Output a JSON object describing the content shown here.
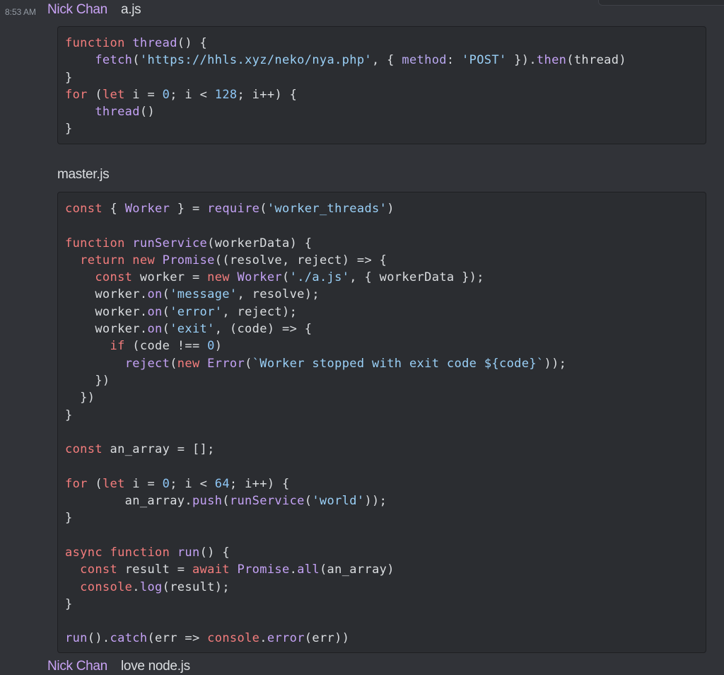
{
  "messages": [
    {
      "timestamp": "8:53 AM",
      "username": "Nick Chan",
      "text": "a.js",
      "code": "function thread() {\n    fetch('https://hhls.xyz/neko/nya.php', { method: 'POST' }).then(thread)\n}\nfor (let i = 0; i < 128; i++) {\n    thread()\n}"
    },
    {
      "text": "master.js",
      "code": "const { Worker } = require('worker_threads')\n\nfunction runService(workerData) {\n  return new Promise((resolve, reject) => {\n    const worker = new Worker('./a.js', { workerData });\n    worker.on('message', resolve);\n    worker.on('error', reject);\n    worker.on('exit', (code) => {\n      if (code !== 0)\n        reject(new Error(`Worker stopped with exit code ${code}`));\n    })\n  })\n}\n\nconst an_array = [];\n\nfor (let i = 0; i < 64; i++) {\n        an_array.push(runService('world'));\n}\n\nasync function run() {\n  const result = await Promise.all(an_array)\n  console.log(result);\n}\n\nrun().catch(err => console.error(err))"
    },
    {
      "username": "Nick Chan",
      "text": "love node.js"
    }
  ],
  "colors": {
    "background": "#313338",
    "codeblock": "#2b2d31",
    "username": "#c9a3f5",
    "keyword": "#f47d7d",
    "function": "#c4a2f5",
    "string": "#9ad0f7",
    "number": "#8ec6f5"
  }
}
